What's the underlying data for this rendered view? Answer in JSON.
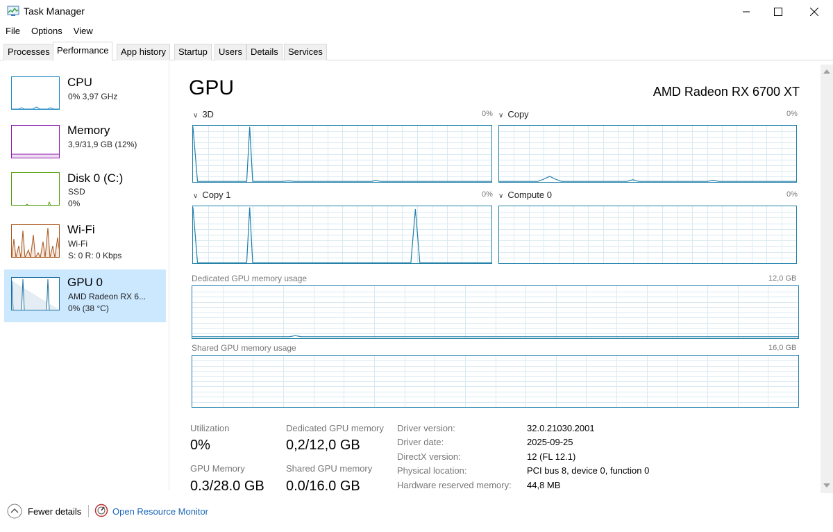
{
  "window": {
    "title": "Task Manager"
  },
  "menu": [
    "File",
    "Options",
    "View"
  ],
  "tabs": [
    "Processes",
    "Performance",
    "App history",
    "Startup",
    "Users",
    "Details",
    "Services"
  ],
  "sidebar": {
    "items": [
      {
        "title": "CPU",
        "sub1": "0% 3,97 GHz",
        "sub2": "",
        "sub3": "",
        "color": "#1c87c6"
      },
      {
        "title": "Memory",
        "sub1": "3,9/31,9 GB (12%)",
        "sub2": "",
        "sub3": "",
        "color": "#8b1aa8"
      },
      {
        "title": "Disk 0 (C:)",
        "sub1": "SSD",
        "sub2": "0%",
        "sub3": "",
        "color": "#4e9a06"
      },
      {
        "title": "Wi-Fi",
        "sub1": "Wi-Fi",
        "sub2": "S: 0 R: 0 Kbps",
        "sub3": "",
        "color": "#a8541a"
      },
      {
        "title": "GPU 0",
        "sub1": "AMD Radeon RX 6...",
        "sub2": "0% (38 °C)",
        "sub3": "",
        "color": "#1c6fa0"
      }
    ]
  },
  "main": {
    "title": "GPU",
    "device": "AMD Radeon RX 6700 XT",
    "engines": [
      {
        "label": "3D",
        "pct": "0%"
      },
      {
        "label": "Copy",
        "pct": "0%"
      },
      {
        "label": "Copy 1",
        "pct": "0%"
      },
      {
        "label": "Compute 0",
        "pct": "0%"
      }
    ],
    "dedicated_label": "Dedicated GPU memory usage",
    "dedicated_cap": "12,0 GB",
    "shared_label": "Shared GPU memory usage",
    "shared_cap": "16,0 GB"
  },
  "stats": {
    "utilization_label": "Utilization",
    "utilization_value": "0%",
    "dedicated_label": "Dedicated GPU memory",
    "dedicated_value": "0,2/12,0 GB",
    "gpu_memory_label": "GPU Memory",
    "gpu_memory_value": "0.3/28.0 GB",
    "shared_label": "Shared GPU memory",
    "shared_value": "0.0/16.0 GB"
  },
  "details": [
    {
      "key": "Driver version:",
      "value": "32.0.21030.2001"
    },
    {
      "key": "Driver date:",
      "value": "2025-09-25"
    },
    {
      "key": "DirectX version:",
      "value": "12 (FL 12.1)"
    },
    {
      "key": "Physical location:",
      "value": "PCI bus 8, device 0, function 0"
    },
    {
      "key": "Hardware reserved memory:",
      "value": "44,8 MB"
    }
  ],
  "footer": {
    "fewer_details": "Fewer details",
    "open_resource_monitor": "Open Resource Monitor"
  },
  "colors": {
    "gpu_line": "#1e7ea8",
    "grid": "#d9eaf2",
    "selected_bg": "#cce8ff",
    "link": "#1a66b8"
  }
}
